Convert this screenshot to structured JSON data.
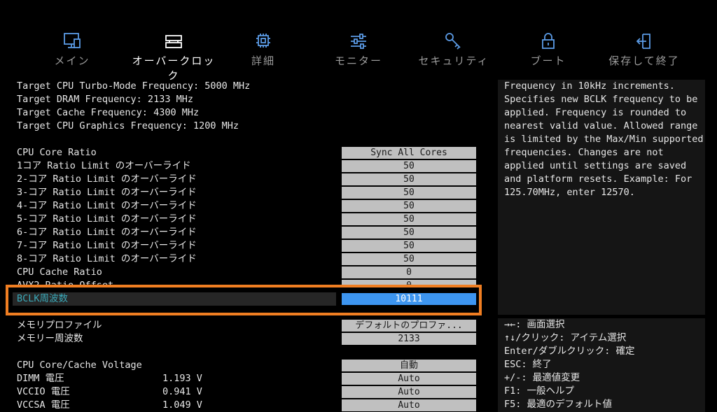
{
  "nav": {
    "tabs": [
      {
        "label": "メイン",
        "icon": "monitor-icon"
      },
      {
        "label": "オーバークロック",
        "icon": "memory-chip-icon"
      },
      {
        "label": "詳細",
        "icon": "cpu-icon"
      },
      {
        "label": "モニター",
        "icon": "sliders-icon"
      },
      {
        "label": "セキュリティ",
        "icon": "key-icon"
      },
      {
        "label": "ブート",
        "icon": "lock-icon"
      },
      {
        "label": "保存して終了",
        "icon": "exit-door-icon"
      }
    ],
    "active_index": 1
  },
  "info_lines": [
    "Target CPU Turbo-Mode Frequency: 5000 MHz",
    "Target DRAM Frequency: 2133 MHz",
    "Target Cache Frequency: 4300 MHz",
    "Target CPU Graphics Frequency: 1200 MHz"
  ],
  "ratio_settings": [
    {
      "label": "CPU Core Ratio",
      "value": "Sync All Cores"
    },
    {
      "label": "1コア Ratio Limit のオーバーライド",
      "value": "50"
    },
    {
      "label": "2-コア Ratio Limit のオーバーライド",
      "value": "50"
    },
    {
      "label": "3-コア Ratio Limit のオーバーライド",
      "value": "50"
    },
    {
      "label": "4-コア Ratio Limit のオーバーライド",
      "value": "50"
    },
    {
      "label": "5-コア Ratio Limit のオーバーライド",
      "value": "50"
    },
    {
      "label": "6-コア Ratio Limit のオーバーライド",
      "value": "50"
    },
    {
      "label": "7-コア Ratio Limit のオーバーライド",
      "value": "50"
    },
    {
      "label": "8-コア Ratio Limit のオーバーライド",
      "value": "50"
    },
    {
      "label": "CPU Cache Ratio",
      "value": "0"
    },
    {
      "label": "AVX2 Ratio Offset",
      "value": "0"
    }
  ],
  "selected_setting": {
    "label": "BCLK周波数",
    "value": "10111"
  },
  "memory_settings": [
    {
      "label": "メモリプロファイル",
      "value": "デフォルトのプロファ..."
    },
    {
      "label": "メモリー周波数",
      "value": "2133"
    }
  ],
  "voltage_settings": [
    {
      "label": "CPU Core/Cache Voltage",
      "reading": "",
      "value": "自動"
    },
    {
      "label": "DIMM 電圧",
      "reading": "1.193 V",
      "value": "Auto"
    },
    {
      "label": "VCCIO 電圧",
      "reading": "0.941 V",
      "value": "Auto"
    },
    {
      "label": "VCCSA 電圧",
      "reading": "1.049 V",
      "value": "Auto"
    }
  ],
  "help_text": "Frequency in 10kHz increments.\nSpecifies new BCLK frequency to be\napplied. Frequency is rounded to\nnearest valid value. Allowed range\nis limited by the Max/Min supported\nfrequencies. Changes are not\napplied until settings are saved\nand platform resets. Example: For\n125.70MHz, enter 12570.",
  "key_help": [
    "→←: 画面選択",
    "↑↓/クリック: アイテム選択",
    "Enter/ダブルクリック: 確定",
    "ESC: 終了",
    "+/-: 最適値変更",
    "F1: 一般ヘルプ",
    "F5: 最適のデフォルト値"
  ],
  "colors": {
    "highlight_border": "#f07e22",
    "selected_value_bg": "#3d95f0",
    "selected_label": "#3aa8b8"
  }
}
